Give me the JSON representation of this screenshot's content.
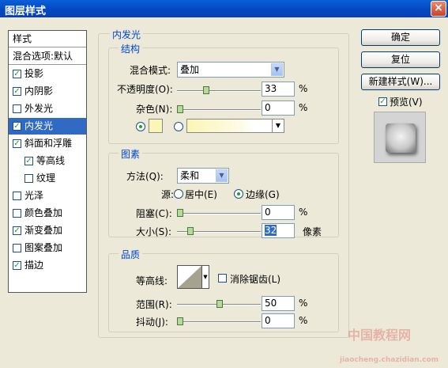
{
  "window": {
    "title": "图层样式",
    "close_glyph": "×"
  },
  "sidebar": {
    "header": "样式",
    "blend_options": "混合选项:默认",
    "items": [
      {
        "label": "投影",
        "checked": true,
        "selected": false
      },
      {
        "label": "内阴影",
        "checked": true,
        "selected": false
      },
      {
        "label": "外发光",
        "checked": false,
        "selected": false
      },
      {
        "label": "内发光",
        "checked": true,
        "selected": true
      },
      {
        "label": "斜面和浮雕",
        "checked": true,
        "selected": false
      },
      {
        "label": "等高线",
        "checked": true,
        "selected": false,
        "sub": true
      },
      {
        "label": "纹理",
        "checked": false,
        "selected": false,
        "sub": true
      },
      {
        "label": "光泽",
        "checked": false,
        "selected": false
      },
      {
        "label": "颜色叠加",
        "checked": false,
        "selected": false
      },
      {
        "label": "渐变叠加",
        "checked": true,
        "selected": false
      },
      {
        "label": "图案叠加",
        "checked": false,
        "selected": false
      },
      {
        "label": "描边",
        "checked": true,
        "selected": false
      }
    ]
  },
  "panel": {
    "title": "内发光",
    "structure": {
      "title": "结构",
      "blend_mode_label": "混合模式:",
      "blend_mode_value": "叠加",
      "opacity_label": "不透明度(O):",
      "opacity_value": "33",
      "opacity_unit": "%",
      "noise_label": "杂色(N):",
      "noise_value": "0",
      "noise_unit": "%",
      "color_swatch": "#fbf6b5"
    },
    "elements": {
      "title": "图素",
      "technique_label": "方法(Q):",
      "technique_value": "柔和",
      "source_label": "源:",
      "source_center": "居中(E)",
      "source_edge": "边缘(G)",
      "choke_label": "阻塞(C):",
      "choke_value": "0",
      "choke_unit": "%",
      "size_label": "大小(S):",
      "size_value": "32",
      "size_unit": "像素"
    },
    "quality": {
      "title": "品质",
      "contour_label": "等高线:",
      "antialias_label": "消除锯齿(L)",
      "range_label": "范围(R):",
      "range_value": "50",
      "range_unit": "%",
      "jitter_label": "抖动(J):",
      "jitter_value": "0",
      "jitter_unit": "%"
    }
  },
  "buttons": {
    "ok": "确定",
    "reset": "复位",
    "new_style": "新建样式(W)...",
    "preview": "预览(V)"
  },
  "watermark": {
    "line1": "中国教程网",
    "line2": "jiaocheng.chazidian.com"
  }
}
